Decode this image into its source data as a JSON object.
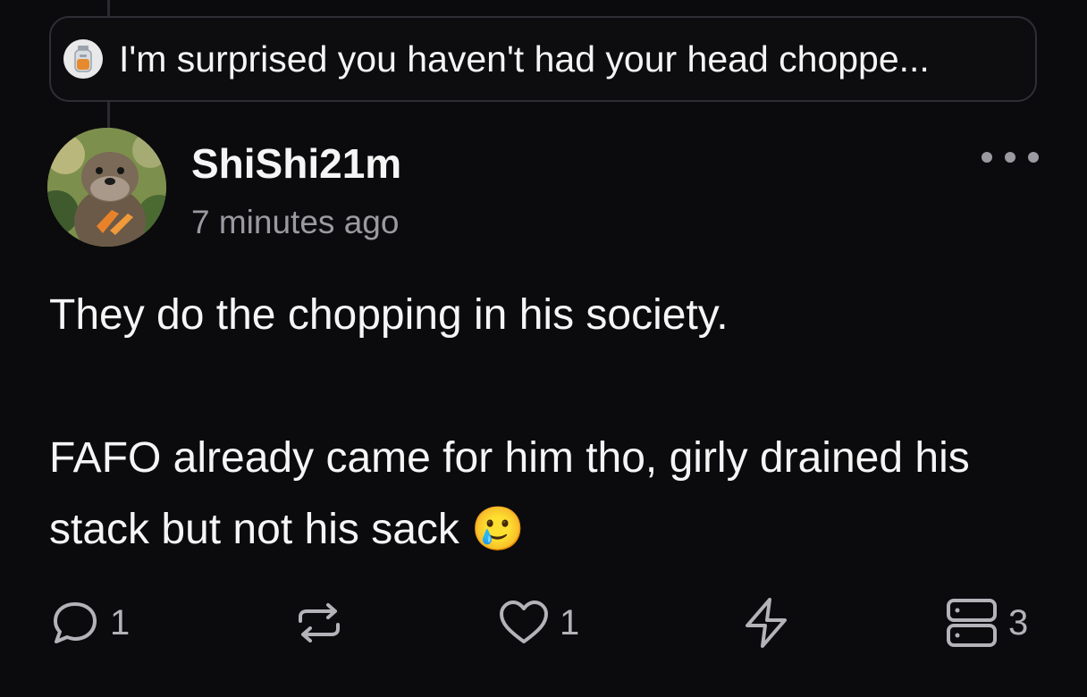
{
  "quote": {
    "text": "I'm surprised you haven't had your head choppe..."
  },
  "post": {
    "username": "ShiShi21m",
    "timestamp": "7 minutes ago",
    "paragraphs": [
      "They do the chopping in his society.",
      "FAFO already came for him tho, girly drained his stack but not his sack"
    ],
    "emoji": "🥲"
  },
  "actions": {
    "comments": "1",
    "likes": "1",
    "stack": "3"
  },
  "colors": {
    "background": "#0b0b0e",
    "muted": "#9a9aa0",
    "icon": "#b3b3b8",
    "border": "#2e2e34"
  },
  "icons": {
    "comment": "comment-bubble-icon",
    "repost": "repost-icon",
    "like": "heart-icon",
    "zap": "lightning-icon",
    "stack": "stack-icon",
    "more": "more-dots-icon"
  }
}
